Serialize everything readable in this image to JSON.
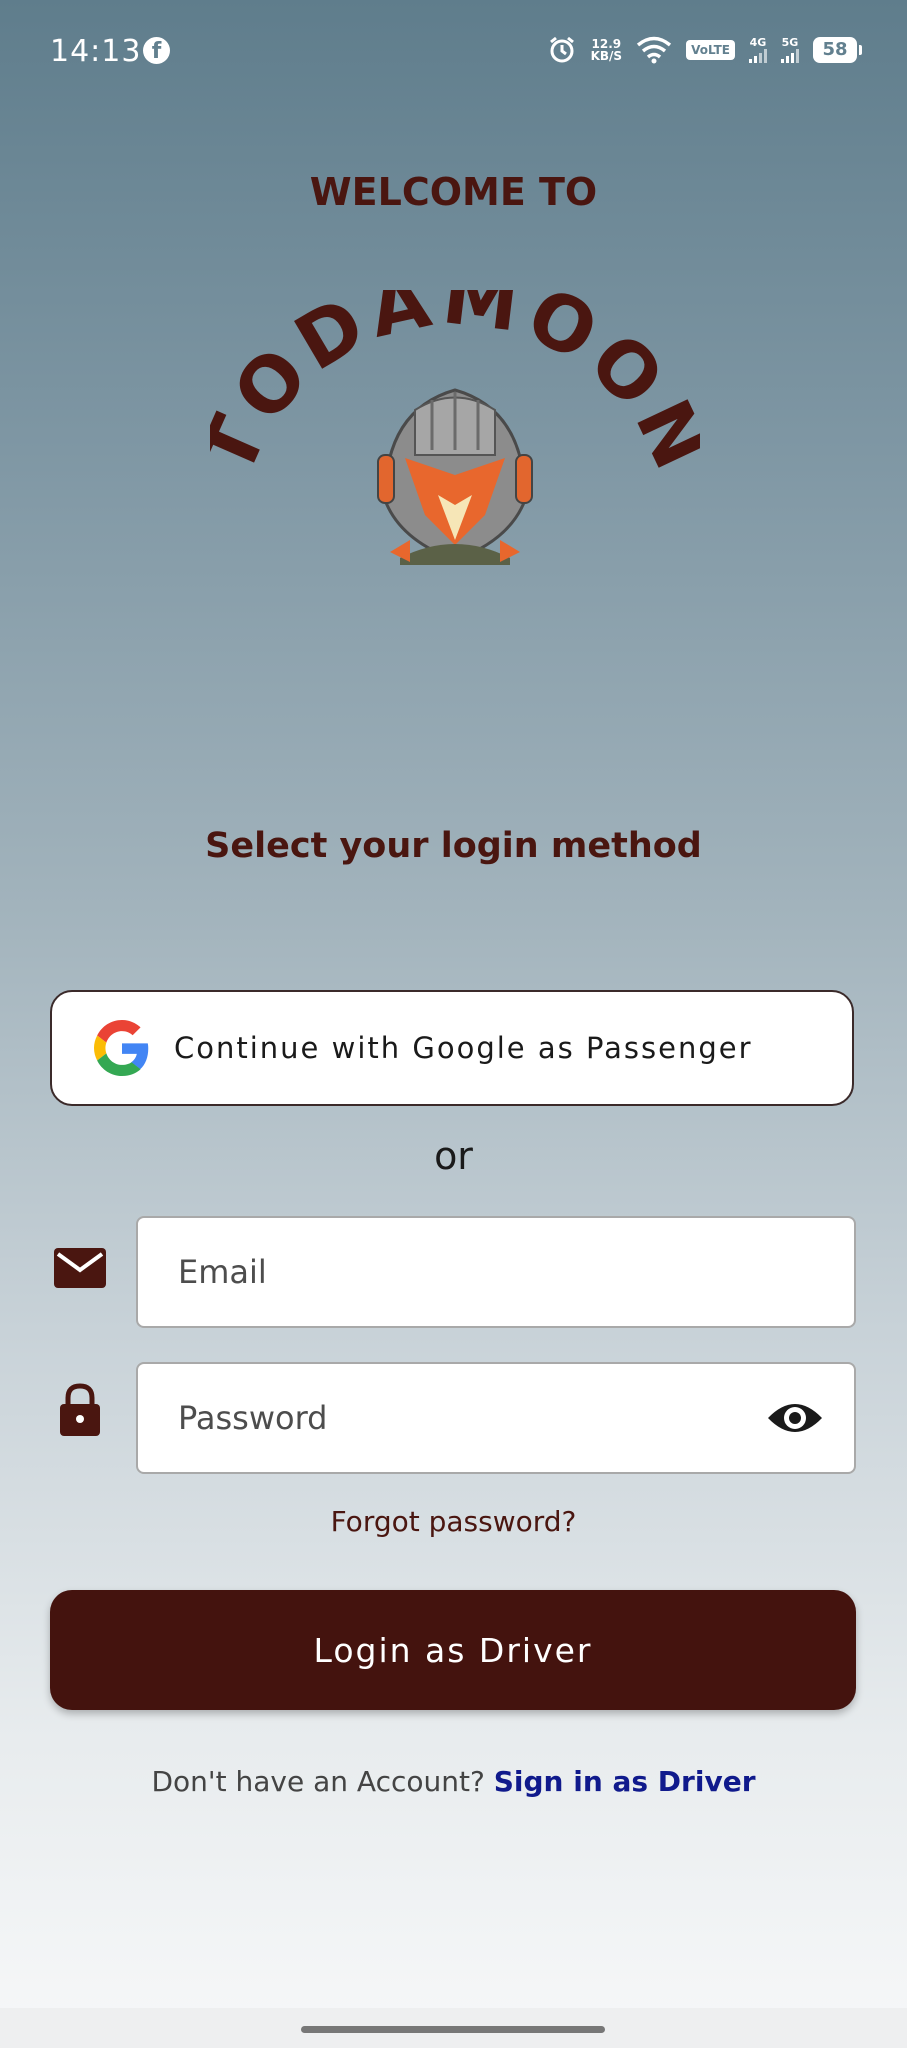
{
  "status_bar": {
    "time": "14:13",
    "net_speed_value": "12.9",
    "net_speed_unit": "KB/S",
    "volte": "VoLTE",
    "sim1_label": "4G",
    "sim2_label": "5G",
    "battery": "58"
  },
  "header": {
    "welcome": "WELCOME TO",
    "logo_text": "TODAMOON"
  },
  "login": {
    "method_title": "Select your login method",
    "google_button": "Continue with Google as Passenger",
    "or": "or",
    "email_placeholder": "Email",
    "password_placeholder": "Password",
    "forgot_password": "Forgot password?",
    "login_button": "Login as Driver",
    "signup_prompt": "Don't have an Account?",
    "signup_link": "Sign in as Driver"
  },
  "icons": {
    "email": "envelope-icon",
    "password": "lock-icon",
    "toggle": "eye-icon",
    "google": "google-icon"
  },
  "colors": {
    "brand": "#44130e",
    "link": "#101a8c"
  }
}
